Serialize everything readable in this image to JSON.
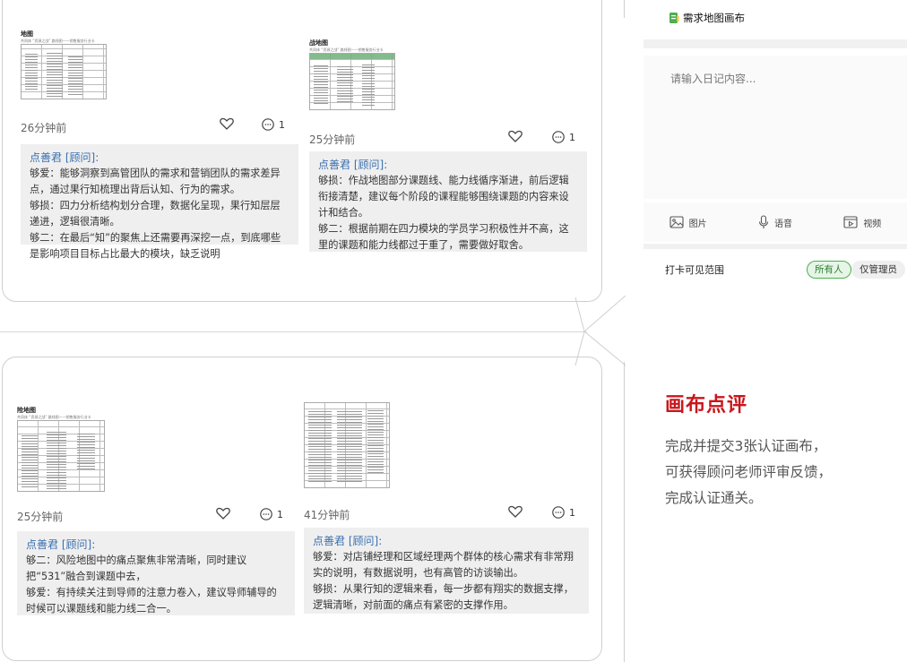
{
  "feed": {
    "posts": [
      {
        "thumb_title": "地图",
        "thumb_sub": "共同体 “资源之战” 路线图——销售服务行业卡",
        "time": "26分钟前",
        "comment_count": "1",
        "reviewer": "点善君",
        "reviewer_tag": "[顾问]",
        "colon": ":",
        "lines": [
          "够爱：能够洞察到高管团队的需求和营销团队的需求差异点，通过果行知梳理出背后认知、行为的需求。",
          "够损：四力分析结构划分合理，数据化呈现，果行知层层递进，逻辑很清晰。",
          "够二：在最后“知”的聚焦上还需要再深挖一点，到底哪些是影响项目目标占比最大的模块，缺乏说明"
        ]
      },
      {
        "thumb_title": "战地图",
        "thumb_sub": "共同体 “资源之战” 路线图——销售服务行业卡",
        "time": "25分钟前",
        "comment_count": "1",
        "reviewer": "点善君",
        "reviewer_tag": "[顾问]",
        "colon": ":",
        "lines": [
          "够损：作战地图部分课题线、能力线循序渐进，前后逻辑衔接清楚，建议每个阶段的课程能够围绕课题的内容来设计和结合。",
          "够二：根据前期在四力模块的学员学习积极性并不高，这里的课题和能力线都过于重了，需要做好取舍。"
        ]
      },
      {
        "thumb_title": "险地图",
        "thumb_sub": "共同体 “资源之战” 路线图——销售服务行业卡",
        "time": "25分钟前",
        "comment_count": "1",
        "reviewer": "点善君",
        "reviewer_tag": "[顾问]",
        "colon": ":",
        "lines": [
          "够二：风险地图中的痛点聚焦非常清晰，同时建议把“531”融合到课题中去，",
          "够爱：有持续关注到导师的注意力卷入，建议导师辅导的时候可以课题线和能力线二合一。"
        ]
      },
      {
        "thumb_title": "",
        "thumb_sub": "",
        "time": "41分钟前",
        "comment_count": "1",
        "reviewer": "点善君",
        "reviewer_tag": "[顾问]",
        "colon": ":",
        "lines": [
          "够爱：对店铺经理和区域经理两个群体的核心需求有非常翔实的说明，有数据说明，也有高管的访谈输出。",
          "够损：从果行知的逻辑来看，每一步都有翔实的数据支撑，逻辑清晰，对前面的痛点有紧密的支撑作用。"
        ]
      }
    ]
  },
  "app": {
    "title": "需求地图画布",
    "placeholder": "请输入日记内容...",
    "media": [
      {
        "label": "图片",
        "icon": "image-icon"
      },
      {
        "label": "语音",
        "icon": "microphone-icon"
      },
      {
        "label": "视频",
        "icon": "video-icon"
      }
    ],
    "scope_label": "打卡可见范围",
    "scope_all": "所有人",
    "scope_admin": "仅管理员"
  },
  "info": {
    "heading": "画布点评",
    "desc_lines": [
      "完成并提交3张认证画布，",
      "可获得顾问老师评审反馈，",
      "完成认证通关。"
    ]
  },
  "colors": {
    "accent_red": "#c9161c",
    "reviewer_blue": "#3a6fb0",
    "brand_green": "#4caf50"
  }
}
